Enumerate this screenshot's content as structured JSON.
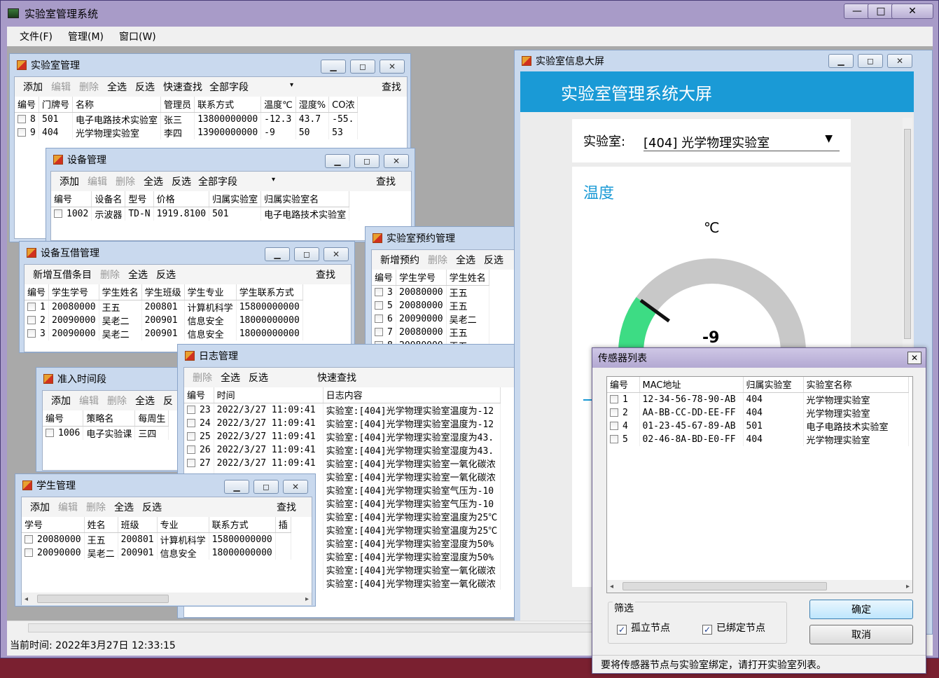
{
  "app": {
    "title": "实验室管理系统",
    "minimize": "—",
    "maximize": "□",
    "close": "✕"
  },
  "menu": [
    "文件(F)",
    "管理(M)",
    "窗口(W)"
  ],
  "status": "当前时间: 2022年3月27日 12:33:15",
  "lab_mgmt": {
    "title": "实验室管理",
    "toolbar": [
      "添加",
      "编辑",
      "删除",
      "全选",
      "反选",
      "快速查找"
    ],
    "field": "全部字段",
    "search": "查找",
    "headers": [
      "编号",
      "门牌号",
      "名称",
      "管理员",
      "联系方式",
      "温度℃",
      "湿度%",
      "CO浓"
    ],
    "rows": [
      [
        "8",
        "501",
        "电子电路技术实验室",
        "张三",
        "13800000000",
        "-12.3",
        "43.7",
        "-55."
      ],
      [
        "9",
        "404",
        "光学物理实验室",
        "李四",
        "13900000000",
        "-9",
        "50",
        "53"
      ]
    ]
  },
  "device_mgmt": {
    "title": "设备管理",
    "toolbar": [
      "添加",
      "编辑",
      "删除",
      "全选",
      "反选"
    ],
    "field": "全部字段",
    "search": "查找",
    "headers": [
      "编号",
      "设备名",
      "型号",
      "价格",
      "归属实验室",
      "归属实验室名"
    ],
    "rows": [
      [
        "1002",
        "示波器",
        "TD-N",
        "1919.8100",
        "501",
        "电子电路技术实验室"
      ]
    ]
  },
  "borrow_mgmt": {
    "title": "设备互借管理",
    "toolbar": [
      "新增互借条目",
      "删除",
      "全选",
      "反选"
    ],
    "search": "查找",
    "headers": [
      "编号",
      "学生学号",
      "学生姓名",
      "学生班级",
      "学生专业",
      "学生联系方式"
    ],
    "rows": [
      [
        "1",
        "20080000",
        "王五",
        "200801",
        "计算机科学",
        "15800000000"
      ],
      [
        "2",
        "20090000",
        "吴老二",
        "200901",
        "信息安全",
        "18000000000"
      ],
      [
        "3",
        "20090000",
        "吴老二",
        "200901",
        "信息安全",
        "18000000000"
      ]
    ]
  },
  "reserve_mgmt": {
    "title": "实验室预约管理",
    "toolbar": [
      "新增预约",
      "删除",
      "全选",
      "反选"
    ],
    "headers": [
      "编号",
      "学生学号",
      "学生姓名"
    ],
    "rows": [
      [
        "3",
        "20080000",
        "王五"
      ],
      [
        "5",
        "20080000",
        "王五"
      ],
      [
        "6",
        "20090000",
        "吴老二"
      ],
      [
        "7",
        "20080000",
        "王五"
      ],
      [
        "8",
        "20080000",
        "王五"
      ]
    ]
  },
  "log_mgmt": {
    "title": "日志管理",
    "toolbar": [
      "删除",
      "全选",
      "反选",
      "快速查找"
    ],
    "headers": [
      "编号",
      "时间",
      "日志内容"
    ],
    "rows": [
      [
        "23",
        "2022/3/27 11:09:41",
        "实验室:[404]光学物理实验室温度为-12"
      ],
      [
        "24",
        "2022/3/27 11:09:41",
        "实验室:[404]光学物理实验室温度为-12"
      ],
      [
        "25",
        "2022/3/27 11:09:41",
        "实验室:[404]光学物理实验室湿度为43."
      ],
      [
        "26",
        "2022/3/27 11:09:41",
        "实验室:[404]光学物理实验室湿度为43."
      ],
      [
        "27",
        "2022/3/27 11:09:41",
        "实验室:[404]光学物理实验室一氧化碳浓"
      ]
    ],
    "more": [
      "实验室:[404]光学物理实验室一氧化碳浓",
      "实验室:[404]光学物理实验室气压为-10",
      "实验室:[404]光学物理实验室气压为-10",
      "实验室:[404]光学物理实验室温度为25℃",
      "实验室:[404]光学物理实验室温度为25℃",
      "实验室:[404]光学物理实验室湿度为50%",
      "实验室:[404]光学物理实验室湿度为50%",
      "实验室:[404]光学物理实验室一氧化碳浓",
      "实验室:[404]光学物理实验室一氧化碳浓"
    ]
  },
  "time_mgmt": {
    "title": "准入时间段",
    "toolbar": [
      "添加",
      "编辑",
      "删除",
      "全选",
      "反"
    ],
    "headers": [
      "编号",
      "策略名",
      "每周生"
    ],
    "rows": [
      [
        "1006",
        "电子实验课",
        "三四"
      ]
    ]
  },
  "student_mgmt": {
    "title": "学生管理",
    "toolbar": [
      "添加",
      "编辑",
      "删除",
      "全选",
      "反选"
    ],
    "search": "查找",
    "headers": [
      "学号",
      "姓名",
      "班级",
      "专业",
      "联系方式",
      "插"
    ],
    "rows": [
      [
        "20080000",
        "王五",
        "200801",
        "计算机科学",
        "15800000000"
      ],
      [
        "20090000",
        "吴老二",
        "200901",
        "信息安全",
        "18000000000"
      ]
    ]
  },
  "big_screen": {
    "title": "实验室信息大屏",
    "header": "实验室管理系统大屏",
    "lab_label": "实验室:",
    "lab_value": "[404] 光学物理实验室",
    "temp_title": "温度",
    "unit": "℃",
    "value": "-9",
    "gauge_fraction": 0.2
  },
  "sensor_dialog": {
    "title": "传感器列表",
    "close": "✕",
    "headers": [
      "编号",
      "MAC地址",
      "归属实验室",
      "实验室名称"
    ],
    "rows": [
      [
        "1",
        "12-34-56-78-90-AB",
        "404",
        "光学物理实验室"
      ],
      [
        "2",
        "AA-BB-CC-DD-EE-FF",
        "404",
        "光学物理实验室"
      ],
      [
        "4",
        "01-23-45-67-89-AB",
        "501",
        "电子电路技术实验室"
      ],
      [
        "5",
        "02-46-8A-BD-E0-FF",
        "404",
        "光学物理实验室"
      ]
    ],
    "filter_label": "筛选",
    "opt_isolated": "孤立节点",
    "opt_bound": "已绑定节点",
    "ok": "确定",
    "cancel": "取消",
    "hint": "要将传感器节点与实验室绑定，请打开实验室列表。"
  },
  "colors": {
    "accent": "#1a9ad6",
    "gauge_fill": "#3ddc84",
    "gauge_track": "#c8c8c8"
  }
}
